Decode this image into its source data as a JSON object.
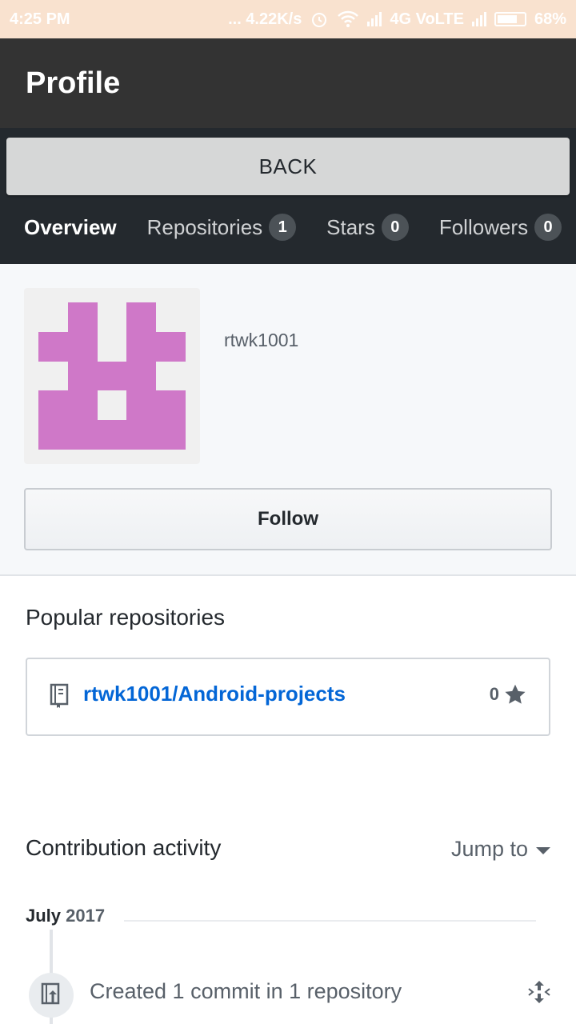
{
  "status_bar": {
    "time": "4:25 PM",
    "speed": "... 4.22K/s",
    "network": "4G VoLTE",
    "battery": "68%"
  },
  "app_bar": {
    "title": "Profile"
  },
  "back_button": {
    "label": "BACK"
  },
  "tabs": [
    {
      "label": "Overview",
      "count": null
    },
    {
      "label": "Repositories",
      "count": "1"
    },
    {
      "label": "Stars",
      "count": "0"
    },
    {
      "label": "Followers",
      "count": "0"
    }
  ],
  "profile": {
    "username": "rtwk1001",
    "avatar_color": "#cf78c8",
    "follow_label": "Follow"
  },
  "popular": {
    "title": "Popular repositories",
    "repos": [
      {
        "name": "rtwk1001/Android-projects",
        "stars": "0"
      }
    ]
  },
  "activity": {
    "title": "Contribution activity",
    "jump_label": "Jump to",
    "month": "July",
    "year": "2017",
    "items": [
      {
        "text": "Created 1 commit in 1 repository"
      }
    ]
  },
  "colors": {
    "link": "#0366d6",
    "header_dark": "#24292e",
    "app_bar": "#333333"
  }
}
